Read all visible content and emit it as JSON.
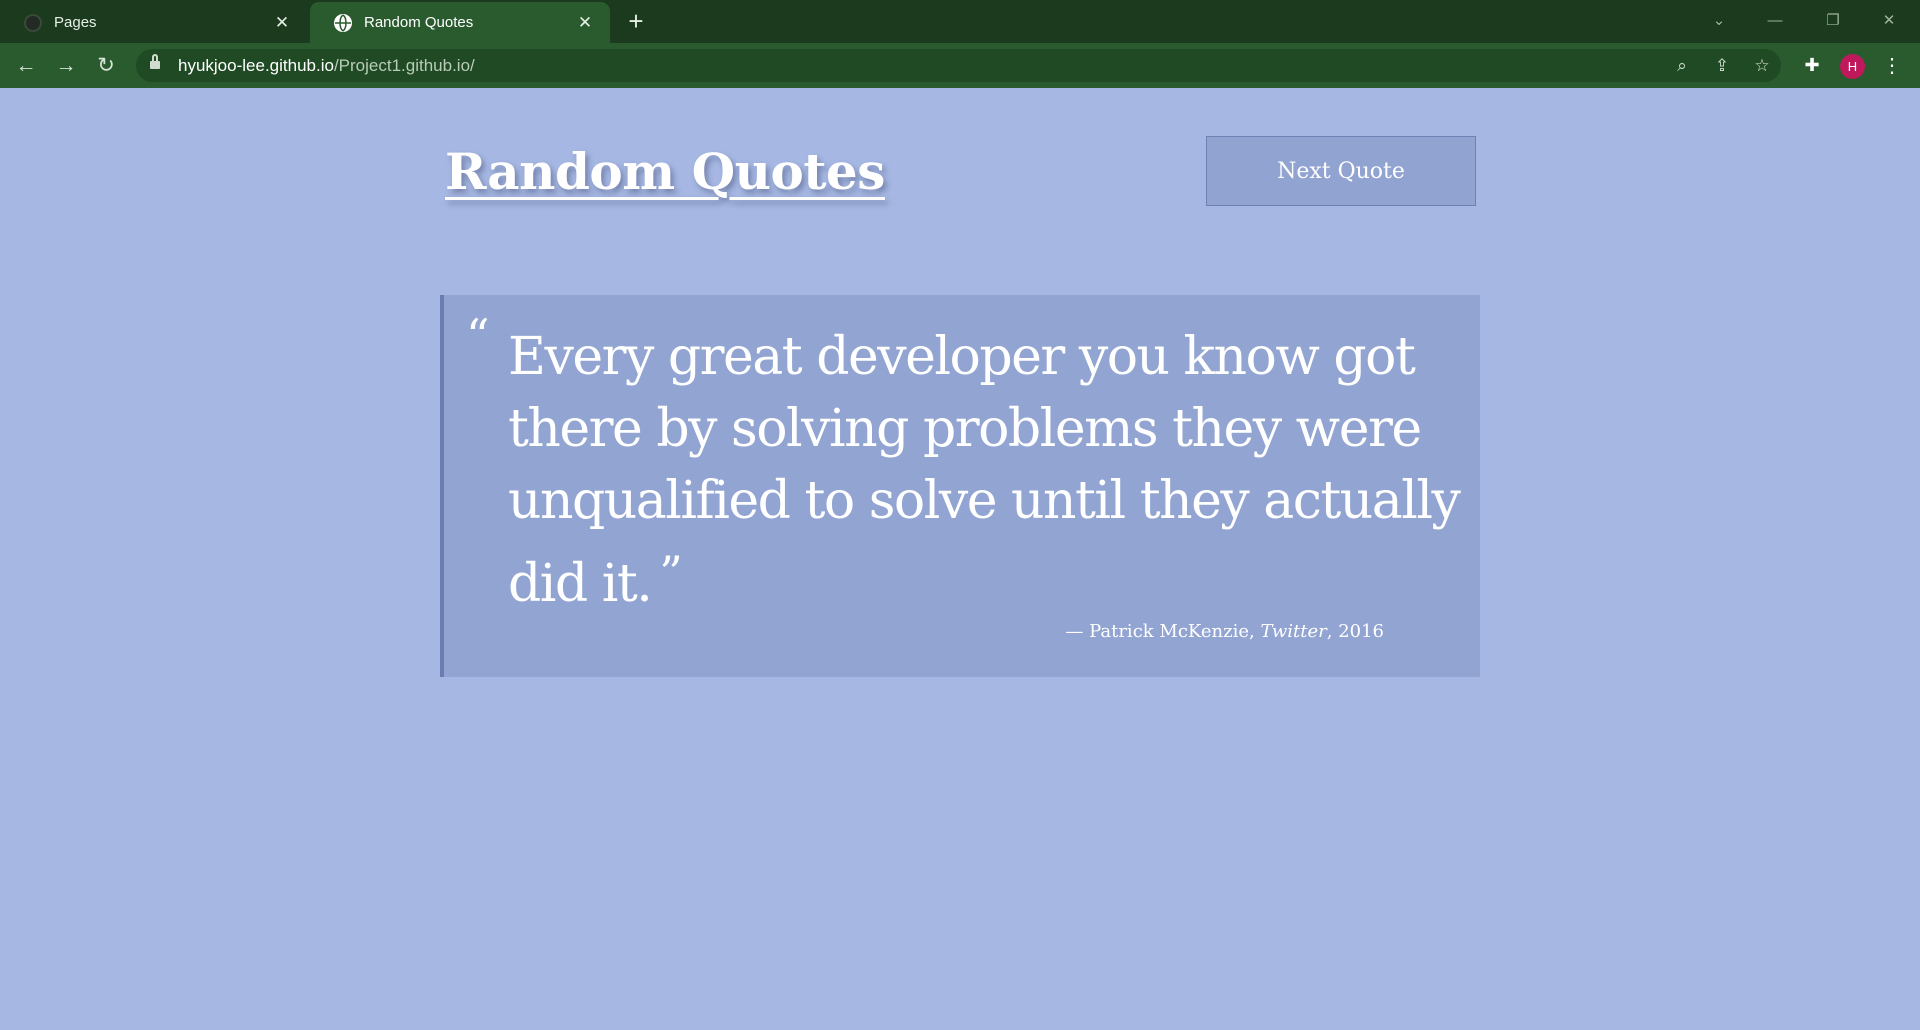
{
  "browser": {
    "tabs": [
      {
        "title": "Pages",
        "active": false
      },
      {
        "title": "Random Quotes",
        "active": true
      }
    ],
    "new_tab": "+",
    "address": {
      "host": "hyukjoo-lee.github.io",
      "path": "/Project1.github.io/"
    },
    "profile_initial": "H"
  },
  "page": {
    "title": "Random Quotes",
    "next_button": "Next Quote",
    "quote": {
      "open_mark": "“",
      "text": "Every great developer you know got there by solving problems they were unqualified to solve until they actually did it.",
      "close_mark": "”",
      "dash": "— ",
      "author": "Patrick McKenzie",
      "separator": ", ",
      "source": "Twitter",
      "year_prefix": ", ",
      "year": "2016"
    }
  },
  "colors": {
    "page_bg": "#a5b7e2",
    "card_bg": "#92a4d1",
    "chrome_dark": "#1b3a1e",
    "chrome_tab": "#2a5b2f",
    "avatar": "#c0195b"
  }
}
